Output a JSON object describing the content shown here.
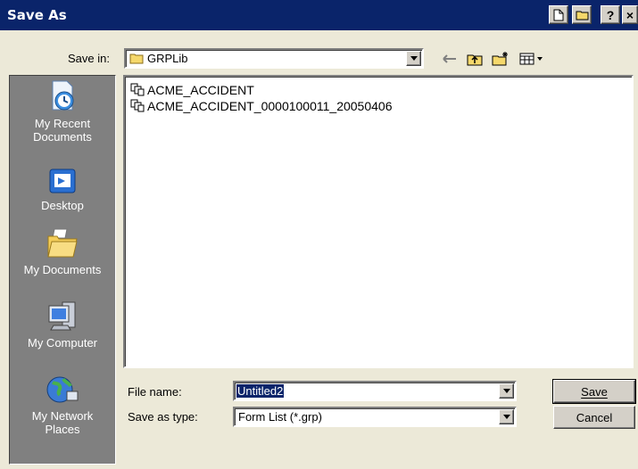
{
  "window": {
    "title": "Save As"
  },
  "title_buttons": {
    "help_label": "?",
    "close_label": "×"
  },
  "save_in": {
    "label": "Save in:",
    "folder": "GRPLib"
  },
  "places": [
    {
      "line1": "My Recent",
      "line2": "Documents",
      "icon": "recent-documents-icon"
    },
    {
      "line1": "Desktop",
      "line2": "",
      "icon": "desktop-icon"
    },
    {
      "line1": "My Documents",
      "line2": "",
      "icon": "my-documents-icon"
    },
    {
      "line1": "My Computer",
      "line2": "",
      "icon": "my-computer-icon"
    },
    {
      "line1": "My Network",
      "line2": "Places",
      "icon": "network-places-icon"
    }
  ],
  "files": [
    {
      "name": "ACME_ACCIDENT"
    },
    {
      "name": "ACME_ACCIDENT_0000100011_20050406"
    }
  ],
  "file_name": {
    "label": "File name:",
    "value": "Untitled2"
  },
  "save_as_type": {
    "label": "Save as type:",
    "value": "Form List (*.grp)"
  },
  "buttons": {
    "save": "Save",
    "cancel": "Cancel"
  },
  "colors": {
    "title_bar": "#0a246a",
    "face": "#d4d0c8",
    "places_bar": "#808080",
    "selection": "#0a246a"
  }
}
